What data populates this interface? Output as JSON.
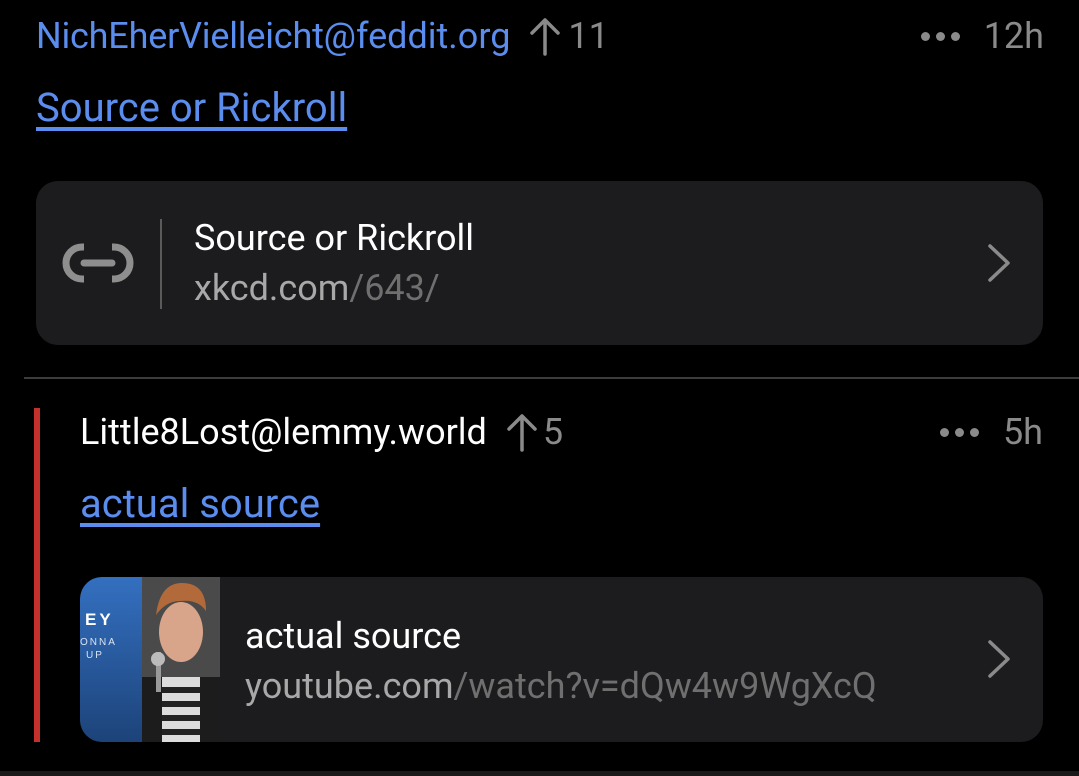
{
  "comment1": {
    "user": "NichEherVielleicht",
    "instance": "@feddit.org",
    "score": "11",
    "time": "12h",
    "link_text": "Source or Rickroll",
    "card": {
      "title": "Source or Rickroll",
      "url_domain": "xkcd.com",
      "url_path": "/643/"
    }
  },
  "comment2": {
    "user": "Little8Lost",
    "instance": "@lemmy.world",
    "score": "5",
    "time": "5h",
    "link_text": "actual source",
    "card": {
      "title": "actual source",
      "url_domain": "youtube.com",
      "url_path": "/watch?v=dQw4w9WgXcQ"
    }
  },
  "colors": {
    "accent": "#5b8def",
    "reply_bar": "#c4302b",
    "card_bg": "#1c1c1e",
    "background": "#000000"
  }
}
